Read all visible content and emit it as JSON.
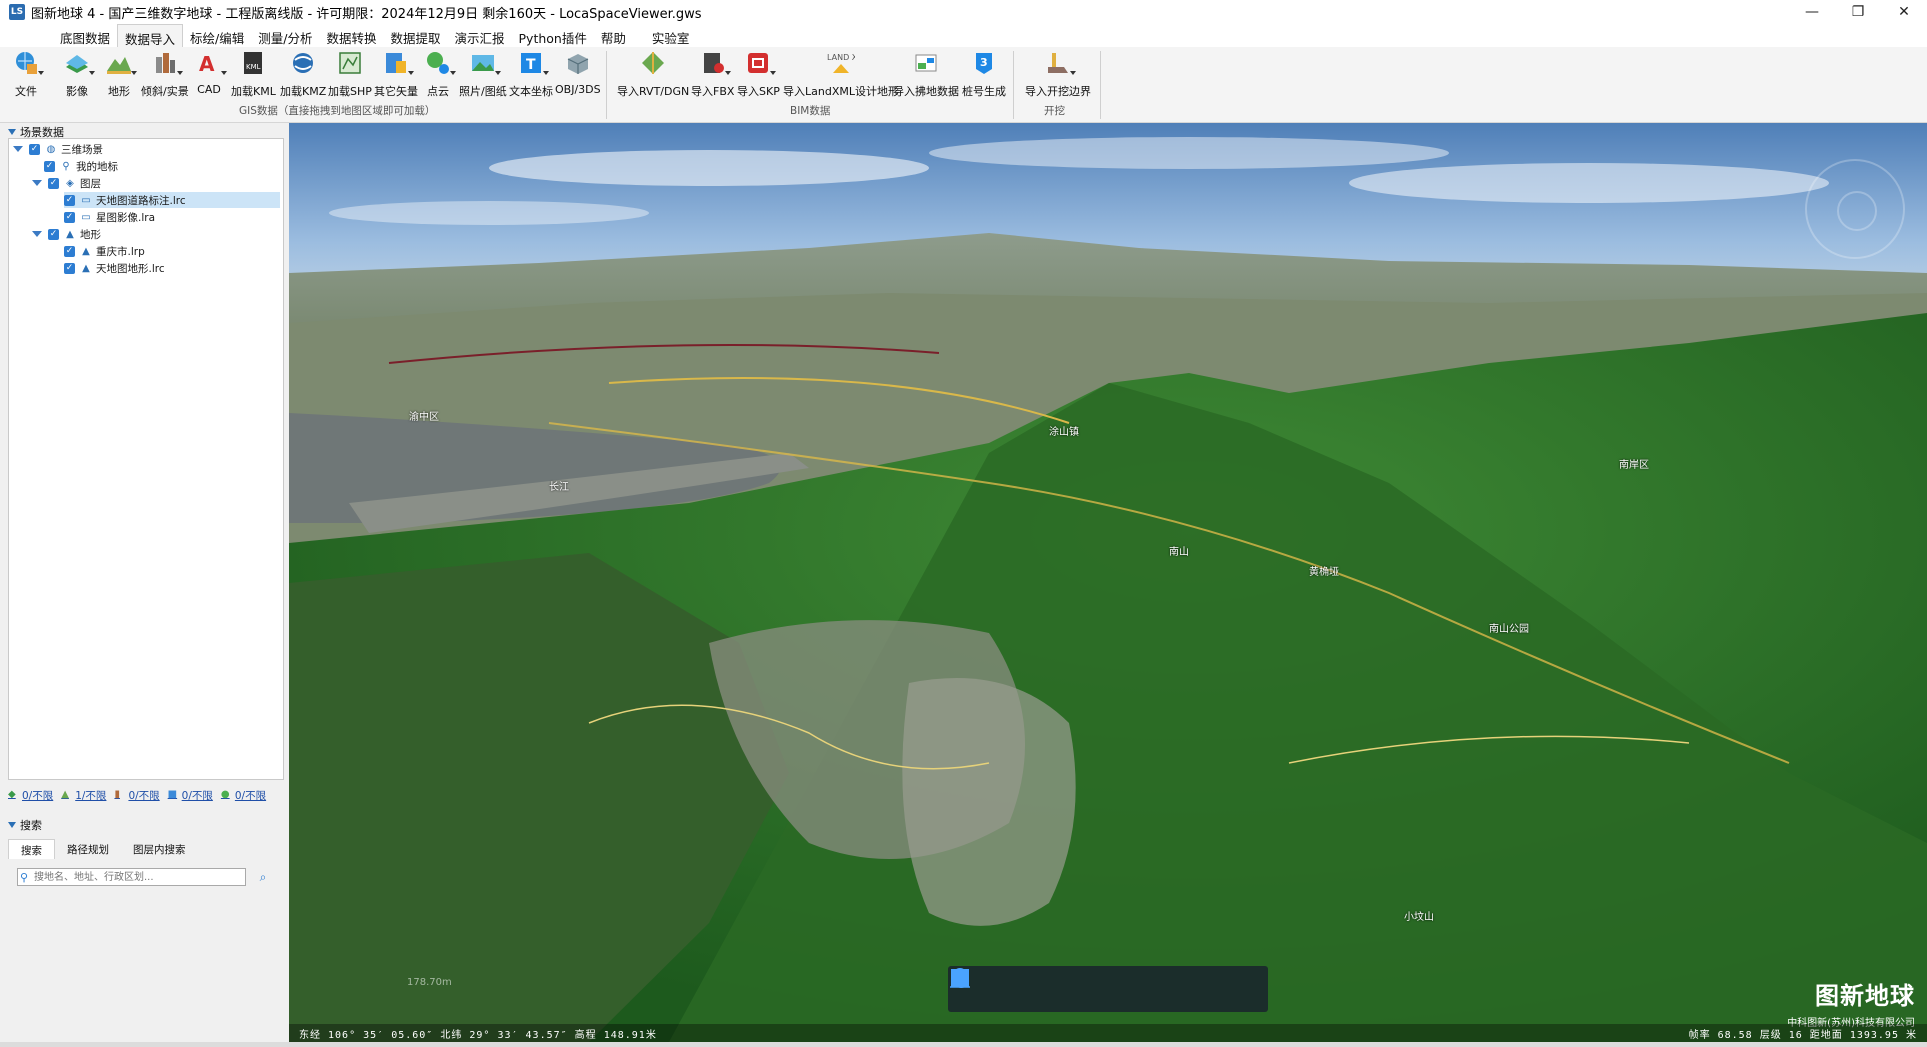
{
  "window": {
    "title": "图新地球 4 - 国产三维数字地球 - 工程版离线版 - 许可期限：2024年12月9日 剩余160天 - LocaSpaceViewer.gws",
    "controls": [
      "—",
      "❐",
      "✕"
    ]
  },
  "menu": {
    "tabs": [
      "底图数据",
      "数据导入",
      "标绘/编辑",
      "测量/分析",
      "数据转换",
      "数据提取",
      "演示汇报",
      "Python插件",
      "帮助",
      "实验室"
    ],
    "active": "数据导入"
  },
  "ribbon": {
    "file": {
      "label": "文件",
      "icon": "globe-file-icon"
    },
    "gis_buttons": [
      {
        "label": "影像",
        "icon": "imagery-icon"
      },
      {
        "label": "地形",
        "icon": "terrain-icon"
      },
      {
        "label": "倾斜/实景",
        "icon": "oblique-icon"
      },
      {
        "label": "CAD",
        "icon": "cad-icon"
      },
      {
        "label": "加载KML",
        "icon": "kml-icon"
      },
      {
        "label": "加载KMZ",
        "icon": "kmz-icon"
      },
      {
        "label": "加载SHP",
        "icon": "shp-icon"
      },
      {
        "label": "其它矢量",
        "icon": "vector-icon"
      },
      {
        "label": "点云",
        "icon": "pointcloud-icon"
      },
      {
        "label": "照片/图纸",
        "icon": "photo-icon"
      },
      {
        "label": "文本坐标",
        "icon": "text-coord-icon"
      },
      {
        "label": "OBJ/3DS",
        "icon": "obj-icon"
      }
    ],
    "gis_group_label": "GIS数据（直接拖拽到地图区域即可加载）",
    "bim_buttons": [
      {
        "label": "导入RVT/DGN",
        "icon": "rvt-icon"
      },
      {
        "label": "导入FBX",
        "icon": "fbx-icon"
      },
      {
        "label": "导入SKP",
        "icon": "skp-icon"
      },
      {
        "label": "导入LandXML设计地形",
        "icon": "landxml-icon",
        "icon_text": "LAND XML"
      },
      {
        "label": "导入拂地数据",
        "icon": "land-data-icon"
      },
      {
        "label": "桩号生成",
        "icon": "stake-icon"
      }
    ],
    "bim_group_label": "BIM数据",
    "dig_buttons": [
      {
        "label": "导入开挖边界",
        "icon": "excavation-icon"
      }
    ],
    "dig_group_label": "开挖"
  },
  "scene_panel": {
    "header": "场景数据",
    "tree": [
      {
        "label": "三维场景",
        "level": 0,
        "icon": "globe-icon",
        "expanded": true
      },
      {
        "label": "我的地标",
        "level": 1,
        "icon": "placemark-icon"
      },
      {
        "label": "图层",
        "level": 1,
        "icon": "layers-icon",
        "expanded": true
      },
      {
        "label": "天地图道路标注.lrc",
        "level": 2,
        "icon": "monitor-icon",
        "selected": true
      },
      {
        "label": "星图影像.lra",
        "level": 2,
        "icon": "monitor-icon"
      },
      {
        "label": "地形",
        "level": 1,
        "icon": "terrain-icon",
        "expanded": true
      },
      {
        "label": "重庆市.lrp",
        "level": 2,
        "icon": "terrain-icon"
      },
      {
        "label": "天地图地形.lrc",
        "level": 2,
        "icon": "terrain-icon"
      }
    ],
    "stats": [
      {
        "icon": "imagery-icon",
        "text": "0/不限"
      },
      {
        "icon": "terrain-icon",
        "text": "1/不限"
      },
      {
        "icon": "oblique-icon",
        "text": "0/不限"
      },
      {
        "icon": "vector-icon",
        "text": "0/不限"
      },
      {
        "icon": "pointcloud-icon",
        "text": "0/不限"
      }
    ]
  },
  "search_panel": {
    "header": "搜索",
    "tabs": [
      "搜索",
      "路径规划",
      "图层内搜索"
    ],
    "active_tab": "搜索",
    "placeholder": "搜地名、地址、行政区划..."
  },
  "viewport": {
    "brand_title": "图新地球",
    "brand_company": "中科图新(苏州)科技有限公司",
    "status_left": "东经 106° 35′ 05.60″  北纬 29° 33′ 43.57″  高程 148.91米",
    "status_right": "帧率 68.58  层级 16  距地面 1393.95 米",
    "scale_text": "178.70m",
    "labels": [
      "长江",
      "渝中区",
      "南山",
      "涂山镇",
      "黄桷垭",
      "小坟山",
      "南山公园",
      "南岸区"
    ],
    "toolbar": [
      "pan-hand-icon",
      "select-arrow-icon",
      "placemark-icon",
      "line-draw-icon",
      "polygon-draw-icon",
      "chart-icon"
    ]
  }
}
